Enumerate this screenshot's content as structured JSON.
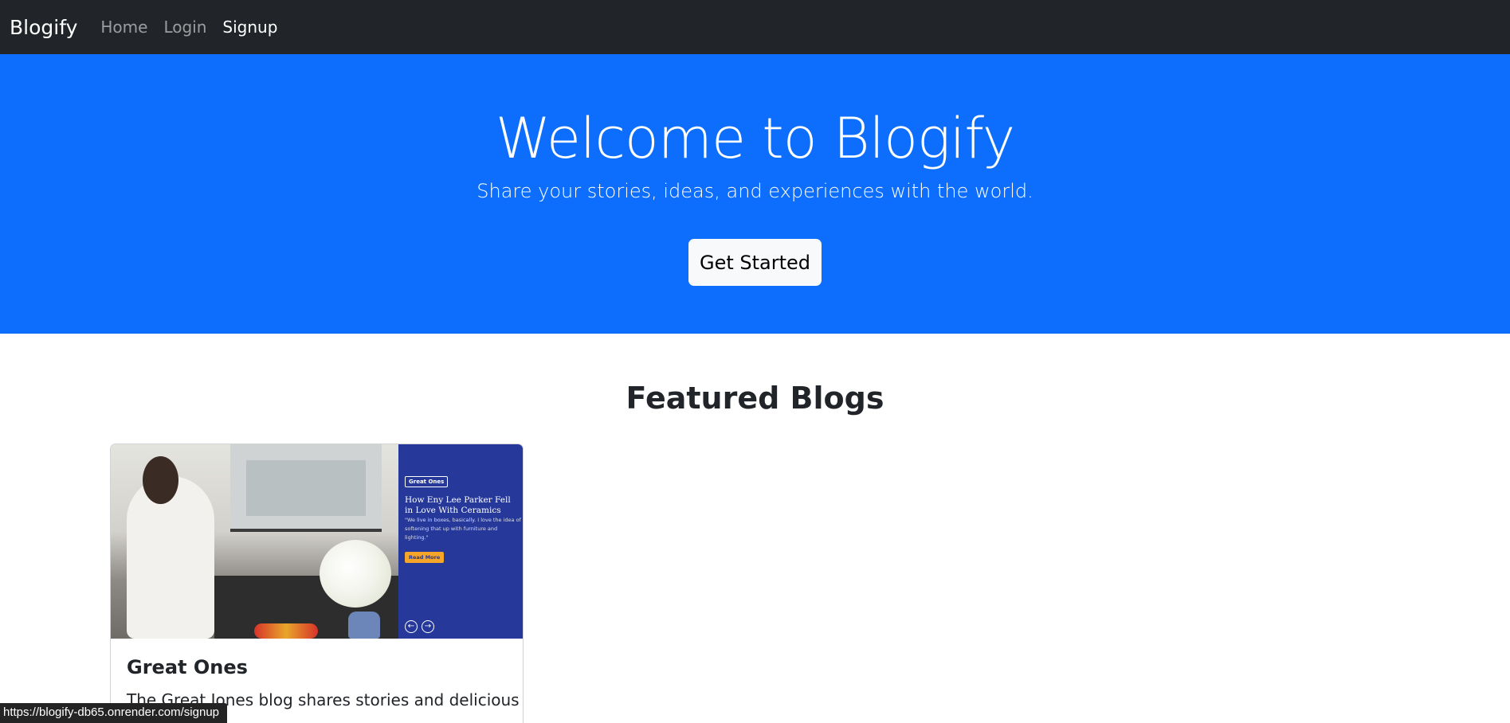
{
  "navbar": {
    "brand": "Blogify",
    "links": [
      "Home",
      "Login",
      "Signup"
    ]
  },
  "hero": {
    "title": "Welcome to Blogify",
    "subtitle": "Share your stories, ideas, and experiences with the world.",
    "button": "Get Started"
  },
  "featured": {
    "heading": "Featured Blogs",
    "cards": [
      {
        "title": "Great Ones",
        "text": "The Great Jones blog shares stories and delicious",
        "image": {
          "tag": "Great Ones",
          "headline": "How Eny Lee Parker Fell in Love With Ceramics",
          "quote": "\"We live in boxes, basically. I love the idea of softening that up with furniture and lighting.\"",
          "cta": "Read More"
        }
      }
    ]
  },
  "status_bar": {
    "url": "https://blogify-db65.onrender.com/signup"
  },
  "colors": {
    "navbar": "#212529",
    "hero": "#0d6efd",
    "promo": "#26399a",
    "cta": "#f4a52a"
  }
}
